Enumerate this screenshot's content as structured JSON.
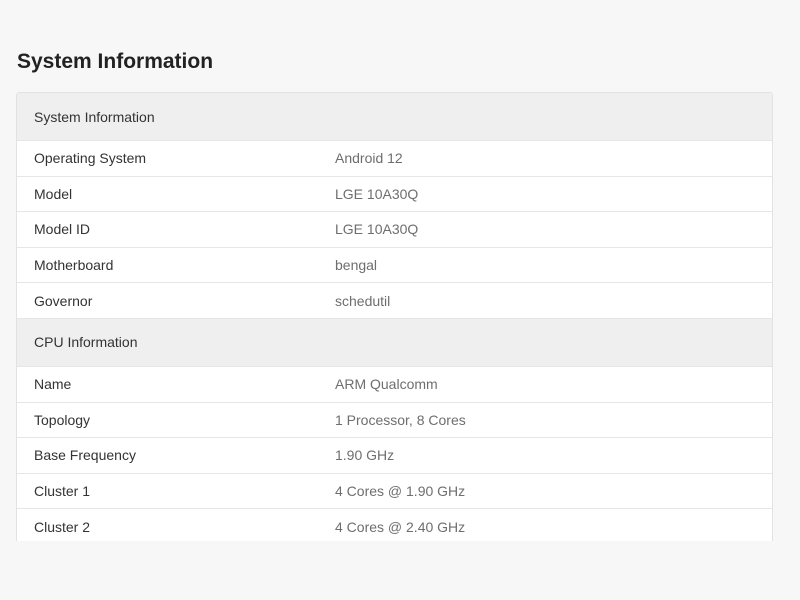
{
  "page": {
    "title": "System Information"
  },
  "sections": [
    {
      "header": "System Information",
      "rows": [
        {
          "label": "Operating System",
          "value": "Android 12"
        },
        {
          "label": "Model",
          "value": "LGE 10A30Q"
        },
        {
          "label": "Model ID",
          "value": "LGE 10A30Q"
        },
        {
          "label": "Motherboard",
          "value": "bengal"
        },
        {
          "label": "Governor",
          "value": "schedutil"
        }
      ]
    },
    {
      "header": "CPU Information",
      "rows": [
        {
          "label": "Name",
          "value": "ARM Qualcomm"
        },
        {
          "label": "Topology",
          "value": "1 Processor, 8 Cores"
        },
        {
          "label": "Base Frequency",
          "value": "1.90 GHz"
        },
        {
          "label": "Cluster 1",
          "value": "4 Cores @ 1.90 GHz"
        },
        {
          "label": "Cluster 2",
          "value": "4 Cores @ 2.40 GHz"
        }
      ]
    }
  ]
}
